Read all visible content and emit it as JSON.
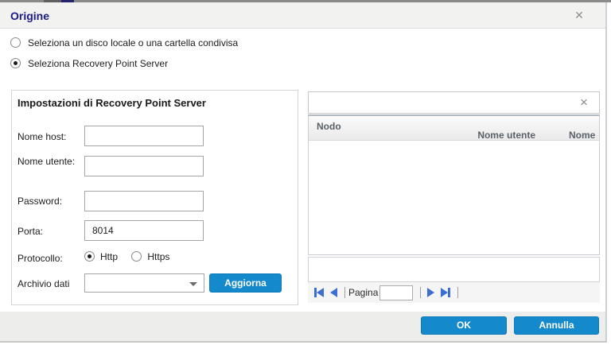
{
  "window": {
    "title": "Origine",
    "close_glyph": "✕"
  },
  "source_options": [
    {
      "label": "Seleziona un disco locale o una cartella condivisa",
      "selected": false
    },
    {
      "label": "Seleziona Recovery Point Server",
      "selected": true
    }
  ],
  "rps_settings": {
    "title": "Impostazioni di Recovery Point Server",
    "fields": [
      {
        "label": "Nome host:",
        "value": ""
      },
      {
        "label": "Nome utente:",
        "value": ""
      },
      {
        "label": "Password:",
        "value": ""
      },
      {
        "label": "Porta:",
        "value": "8014"
      }
    ],
    "protocol": {
      "label": "Protocollo:",
      "options": [
        {
          "label": "Http",
          "selected": true
        },
        {
          "label": "Https",
          "selected": false
        }
      ]
    },
    "datastore": {
      "label": "Archivio dati",
      "selected_value": "",
      "refresh_button": "Aggiorna"
    }
  },
  "node_panel": {
    "clear_glyph": "×",
    "table": {
      "columns": [
        "Nodo",
        "Nome utente",
        "Nome"
      ],
      "rows": []
    },
    "pagination": {
      "page_label": "Pagina",
      "page_value": ""
    }
  },
  "footer": {
    "ok_button": "OK",
    "cancel_button": "Annulla"
  },
  "colors": {
    "accent_blue": "#1489cb",
    "title_navy": "#1b1b8a",
    "pager_arrow_blue": "#3b6fd6",
    "titlebar_gray": "#f2f2f1",
    "footer_gray": "#ededec"
  }
}
